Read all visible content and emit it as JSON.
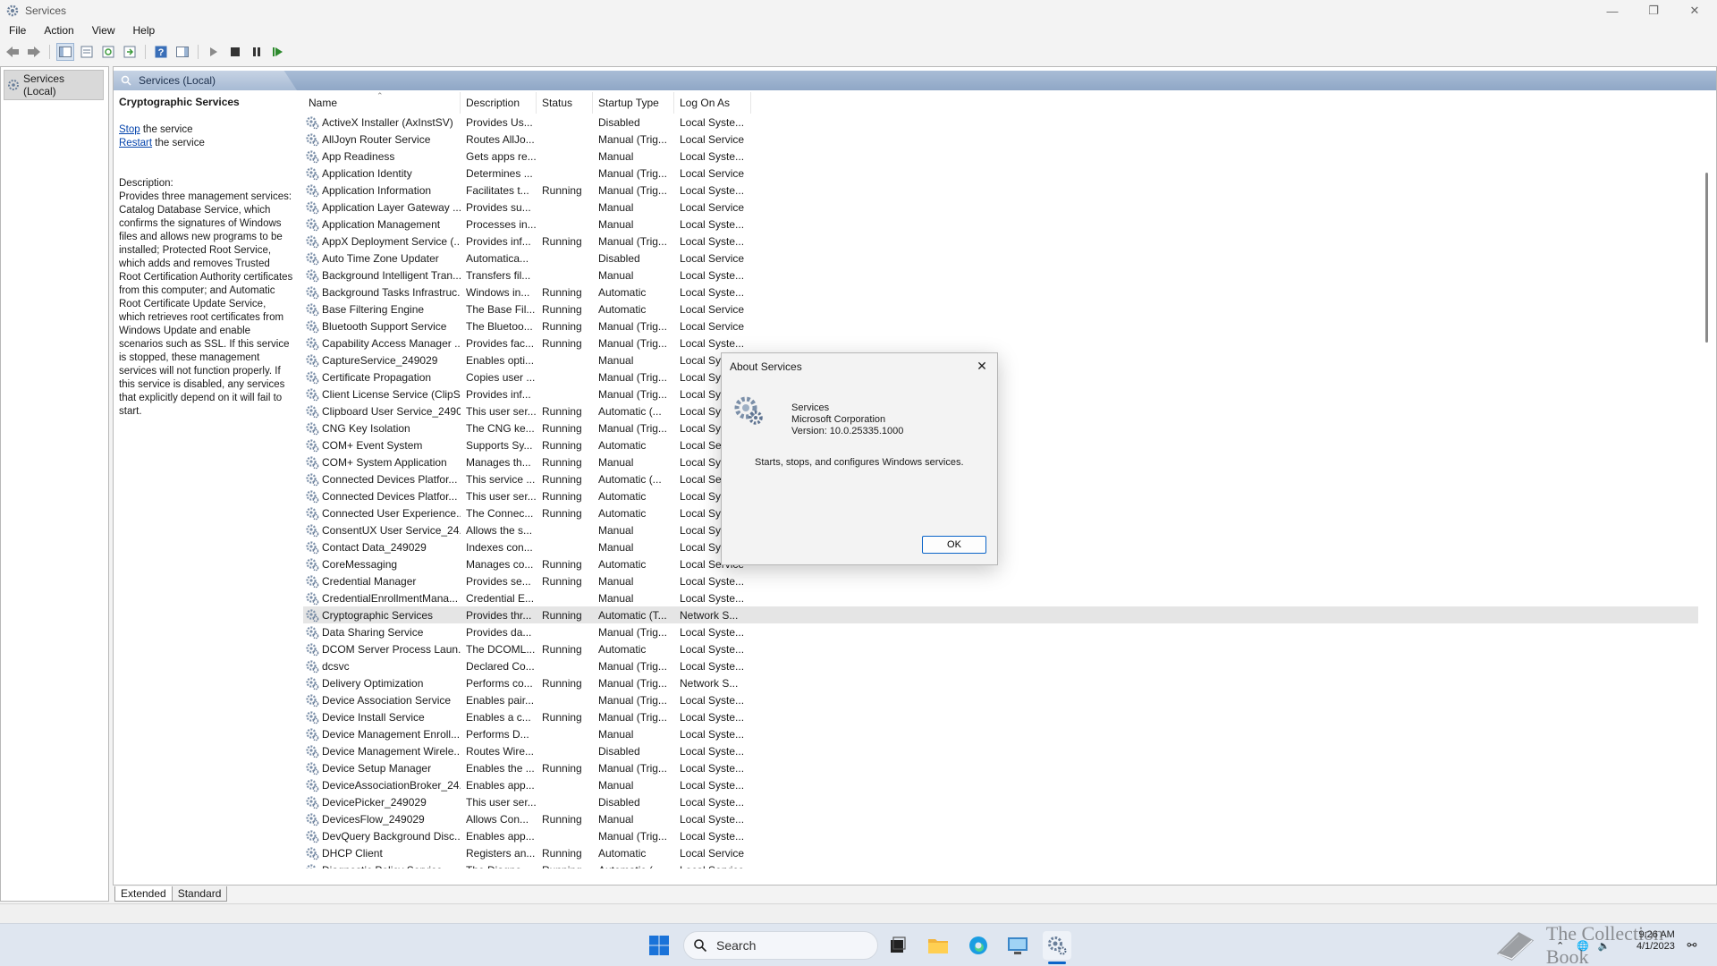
{
  "window": {
    "title": "Services"
  },
  "menu": [
    "File",
    "Action",
    "View",
    "Help"
  ],
  "tree": {
    "root_label": "Services (Local)"
  },
  "main_header": {
    "label": "Services (Local)"
  },
  "description_pane": {
    "service_name": "Cryptographic Services",
    "stop_link": "Stop",
    "stop_suffix": " the service",
    "restart_link": "Restart",
    "restart_suffix": " the service",
    "description_label": "Description:",
    "description_text": "Provides three management services: Catalog Database Service, which confirms the signatures of Windows files and allows new programs to be installed; Protected Root Service, which adds and removes Trusted Root Certification Authority certificates from this computer; and Automatic Root Certificate Update Service, which retrieves root certificates from Windows Update and enable scenarios such as SSL. If this service is stopped, these management services will not function properly. If this service is disabled, any services that explicitly depend on it will fail to start."
  },
  "table": {
    "columns": [
      "Name",
      "Description",
      "Status",
      "Startup Type",
      "Log On As"
    ],
    "selected_row": 29,
    "rows": [
      [
        "ActiveX Installer (AxInstSV)",
        "Provides Us...",
        "",
        "Disabled",
        "Local Syste..."
      ],
      [
        "AllJoyn Router Service",
        "Routes AllJo...",
        "",
        "Manual (Trig...",
        "Local Service"
      ],
      [
        "App Readiness",
        "Gets apps re...",
        "",
        "Manual",
        "Local Syste..."
      ],
      [
        "Application Identity",
        "Determines ...",
        "",
        "Manual (Trig...",
        "Local Service"
      ],
      [
        "Application Information",
        "Facilitates t...",
        "Running",
        "Manual (Trig...",
        "Local Syste..."
      ],
      [
        "Application Layer Gateway ...",
        "Provides su...",
        "",
        "Manual",
        "Local Service"
      ],
      [
        "Application Management",
        "Processes in...",
        "",
        "Manual",
        "Local Syste..."
      ],
      [
        "AppX Deployment Service (...",
        "Provides inf...",
        "Running",
        "Manual (Trig...",
        "Local Syste..."
      ],
      [
        "Auto Time Zone Updater",
        "Automatica...",
        "",
        "Disabled",
        "Local Service"
      ],
      [
        "Background Intelligent Tran...",
        "Transfers fil...",
        "",
        "Manual",
        "Local Syste..."
      ],
      [
        "Background Tasks Infrastruc...",
        "Windows in...",
        "Running",
        "Automatic",
        "Local Syste..."
      ],
      [
        "Base Filtering Engine",
        "The Base Fil...",
        "Running",
        "Automatic",
        "Local Service"
      ],
      [
        "Bluetooth Support Service",
        "The Bluetoo...",
        "Running",
        "Manual (Trig...",
        "Local Service"
      ],
      [
        "Capability Access Manager ...",
        "Provides fac...",
        "Running",
        "Manual (Trig...",
        "Local Syste..."
      ],
      [
        "CaptureService_249029",
        "Enables opti...",
        "",
        "Manual",
        "Local Sy"
      ],
      [
        "Certificate Propagation",
        "Copies user ...",
        "",
        "Manual (Trig...",
        "Local Sy"
      ],
      [
        "Client License Service (ClipS...",
        "Provides inf...",
        "",
        "Manual (Trig...",
        "Local Sy"
      ],
      [
        "Clipboard User Service_2490...",
        "This user ser...",
        "Running",
        "Automatic (...",
        "Local Sy"
      ],
      [
        "CNG Key Isolation",
        "The CNG ke...",
        "Running",
        "Manual (Trig...",
        "Local Sy"
      ],
      [
        "COM+ Event System",
        "Supports Sy...",
        "Running",
        "Automatic",
        "Local Se"
      ],
      [
        "COM+ System Application",
        "Manages th...",
        "Running",
        "Manual",
        "Local Sy"
      ],
      [
        "Connected Devices Platfor...",
        "This service ...",
        "Running",
        "Automatic (...",
        "Local Se"
      ],
      [
        "Connected Devices Platfor...",
        "This user ser...",
        "Running",
        "Automatic",
        "Local Sy"
      ],
      [
        "Connected User Experience...",
        "The Connec...",
        "Running",
        "Automatic",
        "Local Sy"
      ],
      [
        "ConsentUX User Service_24...",
        "Allows the s...",
        "",
        "Manual",
        "Local Sy"
      ],
      [
        "Contact Data_249029",
        "Indexes con...",
        "",
        "Manual",
        "Local Sy"
      ],
      [
        "CoreMessaging",
        "Manages co...",
        "Running",
        "Automatic",
        "Local Service"
      ],
      [
        "Credential Manager",
        "Provides se...",
        "Running",
        "Manual",
        "Local Syste..."
      ],
      [
        "CredentialEnrollmentMana...",
        "Credential E...",
        "",
        "Manual",
        "Local Syste..."
      ],
      [
        "Cryptographic Services",
        "Provides thr...",
        "Running",
        "Automatic (T...",
        "Network S..."
      ],
      [
        "Data Sharing Service",
        "Provides da...",
        "",
        "Manual (Trig...",
        "Local Syste..."
      ],
      [
        "DCOM Server Process Laun...",
        "The DCOML...",
        "Running",
        "Automatic",
        "Local Syste..."
      ],
      [
        "dcsvc",
        "Declared Co...",
        "",
        "Manual (Trig...",
        "Local Syste..."
      ],
      [
        "Delivery Optimization",
        "Performs co...",
        "Running",
        "Manual (Trig...",
        "Network S..."
      ],
      [
        "Device Association Service",
        "Enables pair...",
        "",
        "Manual (Trig...",
        "Local Syste..."
      ],
      [
        "Device Install Service",
        "Enables a c...",
        "Running",
        "Manual (Trig...",
        "Local Syste..."
      ],
      [
        "Device Management Enroll...",
        "Performs D...",
        "",
        "Manual",
        "Local Syste..."
      ],
      [
        "Device Management Wirele...",
        "Routes Wire...",
        "",
        "Disabled",
        "Local Syste..."
      ],
      [
        "Device Setup Manager",
        "Enables the ...",
        "Running",
        "Manual (Trig...",
        "Local Syste..."
      ],
      [
        "DeviceAssociationBroker_24...",
        "Enables app...",
        "",
        "Manual",
        "Local Syste..."
      ],
      [
        "DevicePicker_249029",
        "This user ser...",
        "",
        "Disabled",
        "Local Syste..."
      ],
      [
        "DevicesFlow_249029",
        "Allows Con...",
        "Running",
        "Manual",
        "Local Syste..."
      ],
      [
        "DevQuery Background Disc...",
        "Enables app...",
        "",
        "Manual (Trig...",
        "Local Syste..."
      ],
      [
        "DHCP Client",
        "Registers an...",
        "Running",
        "Automatic",
        "Local Service"
      ],
      [
        "Diagnostic Policy Service",
        "The Diagno...",
        "Running",
        "Automatic (...",
        "Local Service"
      ]
    ]
  },
  "tabs": {
    "extended": "Extended",
    "standard": "Standard"
  },
  "dialog": {
    "title": "About Services",
    "product": "Services",
    "company": "Microsoft Corporation",
    "version": "Version: 10.0.25335.1000",
    "body": "Starts, stops, and configures Windows services.",
    "ok_label": "OK"
  },
  "taskbar": {
    "search_placeholder": "Search",
    "time": "9:26 AM",
    "date": "4/1/2023",
    "watermark": "The Collection Book"
  },
  "colors": {
    "accent": "#0a64c8",
    "header_blue": "#8fa7c6",
    "selected_row": "#e5e5e5"
  }
}
